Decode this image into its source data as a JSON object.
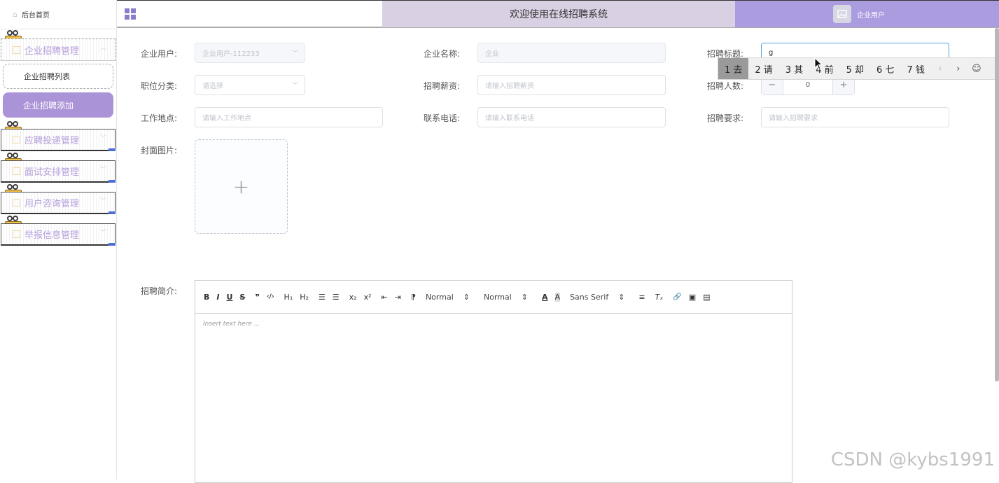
{
  "sidebar": {
    "home_label": "后台首页",
    "groups": [
      {
        "label": "企业招聘管理"
      },
      {
        "label": "应聘投递管理"
      },
      {
        "label": "面试安排管理"
      },
      {
        "label": "用户咨询管理"
      },
      {
        "label": "举报信息管理"
      }
    ],
    "sub_items": [
      {
        "label": "企业招聘列表",
        "active": false
      },
      {
        "label": "企业招聘添加",
        "active": true
      }
    ]
  },
  "header": {
    "title": "欢迎使用在线招聘系统",
    "user_label": "企业用户",
    "title_bg": "#d9d0e3",
    "user_bg": "#ab9ce0"
  },
  "form": {
    "company_user": {
      "label": "企业用户:",
      "value": "企业用户-112233"
    },
    "company_name": {
      "label": "企业名称:",
      "placeholder": "企业"
    },
    "recruit_title": {
      "label": "招聘标题:",
      "value": "g"
    },
    "job_category": {
      "label": "职位分类:",
      "placeholder": "请选择"
    },
    "salary": {
      "label": "招聘薪资:",
      "placeholder": "请输入招聘薪资"
    },
    "headcount": {
      "label": "招聘人数:",
      "value": "0",
      "minus": "−",
      "plus": "+"
    },
    "location": {
      "label": "工作地点:",
      "placeholder": "请输入工作地点"
    },
    "phone": {
      "label": "联系电话:",
      "placeholder": "请输入联系电话"
    },
    "requirement": {
      "label": "招聘要求:",
      "placeholder": "请输入招聘要求"
    },
    "cover": {
      "label": "封面图片:",
      "plus": "+"
    },
    "intro": {
      "label": "招聘简介:",
      "placeholder": "Insert text here ..."
    }
  },
  "editor_toolbar": {
    "bold": "B",
    "italic": "I",
    "underline": "U",
    "strike": "S",
    "quote": "❞",
    "code": "‹/›",
    "h1": "H₁",
    "h2": "H₂",
    "ordered": "☰",
    "bullet": "☰",
    "sub": "x₂",
    "sup": "x²",
    "outdent": "⇤",
    "indent": "⇥",
    "direction": "⁋",
    "size_select": "Normal",
    "header_select": "Normal",
    "color": "A",
    "background": "A",
    "font_select": "Sans Serif",
    "align": "≡",
    "clean": "Tₓ",
    "link": "🔗",
    "image": "▣",
    "video": "▤"
  },
  "ime": {
    "candidates": [
      "1 去",
      "2 请",
      "3 其",
      "4 前",
      "5 却",
      "6 七",
      "7 钱"
    ],
    "prev": "‹",
    "next": "›",
    "emoji": "☺"
  },
  "watermark": "CSDN @kybs1991"
}
